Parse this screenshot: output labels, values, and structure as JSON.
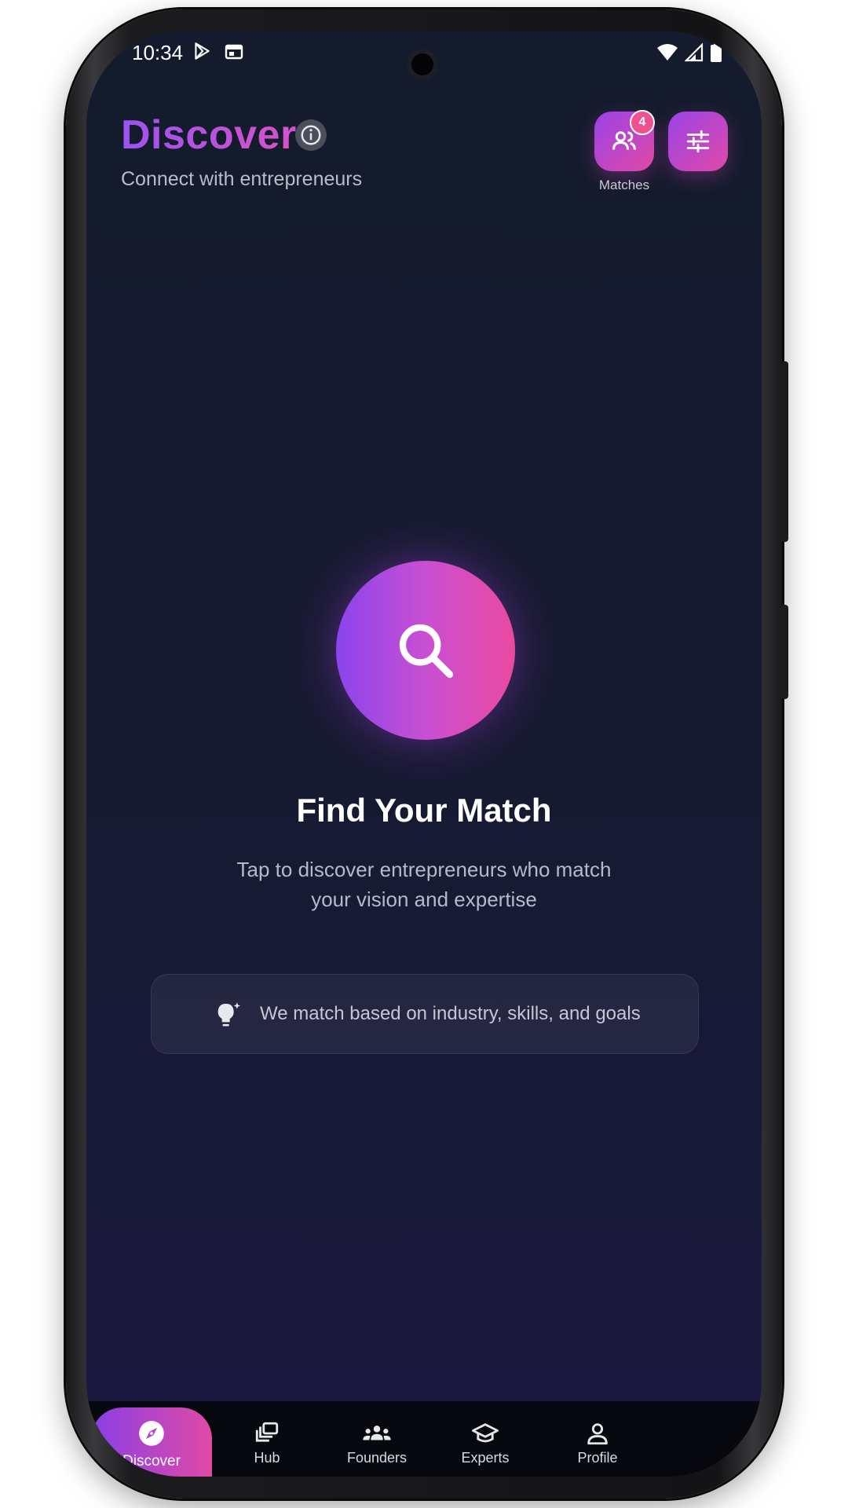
{
  "status_bar": {
    "time": "10:34"
  },
  "header": {
    "title": "Discover",
    "subtitle": "Connect with entrepreneurs",
    "matches_label": "Matches",
    "matches_badge": "4"
  },
  "main": {
    "heading": "Find Your Match",
    "description": "Tap to discover entrepreneurs who match your vision and expertise",
    "hint": "We match based on industry, skills, and goals"
  },
  "nav": {
    "items": [
      {
        "label": "Discover",
        "icon": "compass-icon",
        "active": true
      },
      {
        "label": "Hub",
        "icon": "cards-icon",
        "active": false
      },
      {
        "label": "Founders",
        "icon": "people-icon",
        "active": false
      },
      {
        "label": "Experts",
        "icon": "graduation-cap-icon",
        "active": false
      },
      {
        "label": "Profile",
        "icon": "person-icon",
        "active": false
      }
    ]
  },
  "colors": {
    "accent_start": "#8b44ec",
    "accent_end": "#ea4a9f",
    "background": "#151a2e",
    "badge": "#f0508f"
  }
}
